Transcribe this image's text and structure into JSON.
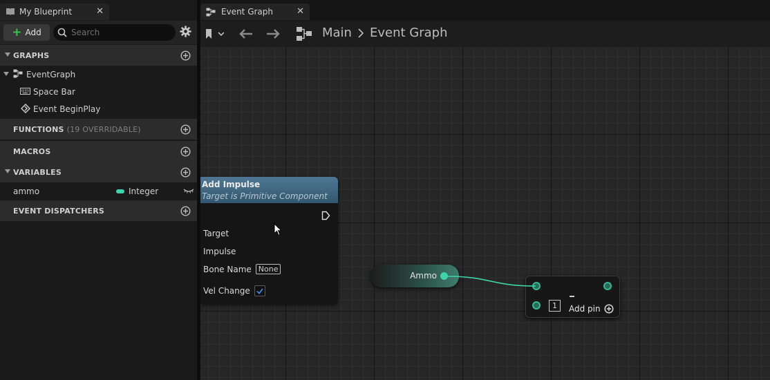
{
  "left_panel": {
    "tab_title": "My Blueprint",
    "add_label": "Add",
    "search_placeholder": "Search",
    "sections": {
      "graphs": "GRAPHS",
      "functions": "FUNCTIONS",
      "functions_sub": "(19 OVERRIDABLE)",
      "macros": "MACROS",
      "variables": "VARIABLES",
      "event_dispatchers": "EVENT DISPATCHERS"
    },
    "graph_items": {
      "event_graph": "EventGraph",
      "space_bar": "Space Bar",
      "begin_play": "Event BeginPlay"
    },
    "variable": {
      "name": "ammo",
      "type": "Integer",
      "type_color": "#3ed3ab"
    }
  },
  "graph_tab": {
    "title": "Event Graph"
  },
  "breadcrumb": {
    "root": "Main",
    "current": "Event Graph"
  },
  "nodes": {
    "add_impulse": {
      "title": "Add Impulse",
      "subtitle": "Target is Primitive Component",
      "pins": {
        "target": "Target",
        "impulse": "Impulse",
        "bone_name": "Bone Name",
        "bone_name_value": "None",
        "vel_change": "Vel Change"
      },
      "vel_change_checked": true
    },
    "ammo": {
      "label": "Ammo"
    },
    "make_array": {
      "index": "1",
      "add_pin": "Add pin"
    }
  },
  "colors": {
    "integer_pin": "#3ed3ab",
    "node_header": "#4f7794",
    "add_green": "#38c24a"
  }
}
